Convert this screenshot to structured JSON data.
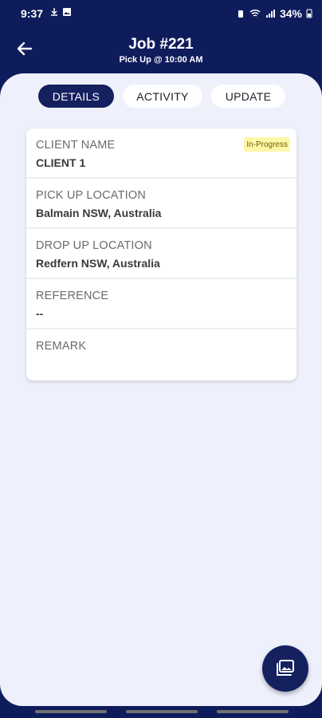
{
  "statusbar": {
    "time": "9:37",
    "battery": "34%",
    "icons_left": [
      "download-icon",
      "image-icon"
    ],
    "icons_right": [
      "alarm-icon",
      "wifi-icon",
      "signal-icon",
      "battery-icon"
    ]
  },
  "header": {
    "title": "Job #221",
    "subtitle": "Pick Up @ 10:00 AM"
  },
  "tabs": [
    {
      "label": "DETAILS",
      "active": true
    },
    {
      "label": "ACTIVITY",
      "active": false
    },
    {
      "label": "UPDATE",
      "active": false
    }
  ],
  "fields": {
    "client": {
      "label": "CLIENT NAME",
      "value": "CLIENT 1",
      "badge": "In-Progress"
    },
    "pickup": {
      "label": "PICK UP LOCATION",
      "value": "Balmain NSW, Australia"
    },
    "dropoff": {
      "label": "DROP UP LOCATION",
      "value": "Redfern NSW, Australia"
    },
    "reference": {
      "label": "REFERENCE",
      "value": "--"
    },
    "remark": {
      "label": "REMARK",
      "value": ""
    }
  },
  "colors": {
    "primary": "#15205f",
    "background": "#eef0fc",
    "badge": "#fff7a8"
  }
}
